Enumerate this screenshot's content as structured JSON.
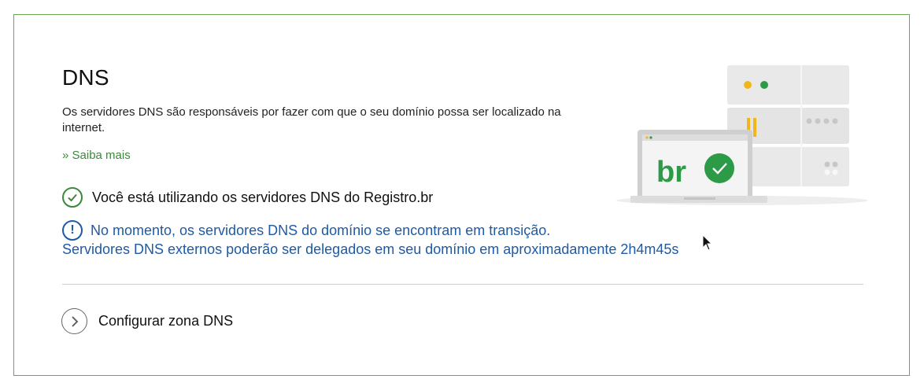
{
  "section": {
    "title": "DNS",
    "description": "Os servidores DNS são responsáveis por fazer com que o seu domínio possa ser localizado na internet.",
    "learn_more": "» Saiba mais"
  },
  "status": {
    "ok_text": "Você está utilizando os servidores DNS do Registro.br",
    "warning_line1": "No momento, os servidores DNS do domínio se encontram em transição.",
    "warning_line2": "Servidores DNS externos poderão ser delegados em seu domínio em aproximadamente 2h4m45s"
  },
  "actions": {
    "configure_zone": "Configurar zona DNS"
  },
  "illustration": {
    "laptop_text": "br"
  },
  "colors": {
    "green": "#3a8a3a",
    "blue": "#1e5aa6",
    "border": "#6aa84f"
  }
}
